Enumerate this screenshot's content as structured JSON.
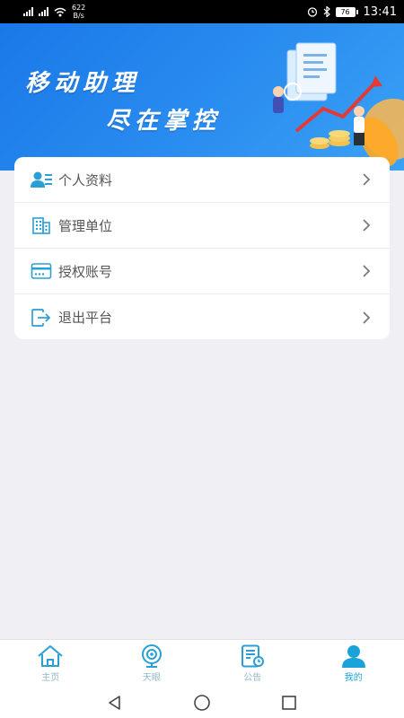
{
  "status_bar": {
    "network_speed": "622",
    "network_speed_unit": "B/s",
    "battery": "76",
    "time": "13:41"
  },
  "banner": {
    "line1": "移动助理",
    "line2": "尽在掌控"
  },
  "menu": {
    "items": [
      {
        "label": "个人资料",
        "icon": "profile-card-icon"
      },
      {
        "label": "管理单位",
        "icon": "building-icon"
      },
      {
        "label": "授权账号",
        "icon": "account-card-icon"
      },
      {
        "label": "退出平台",
        "icon": "exit-icon"
      }
    ]
  },
  "tabbar": {
    "active_index": 3,
    "items": [
      {
        "label": "主页",
        "icon": "home-icon"
      },
      {
        "label": "天眼",
        "icon": "camera-eye-icon"
      },
      {
        "label": "公告",
        "icon": "notice-icon"
      },
      {
        "label": "我的",
        "icon": "user-icon"
      }
    ]
  },
  "colors": {
    "accent": "#1aa3d9",
    "banner_blue": "#1a78e8",
    "icon_blue": "#2a9fd6",
    "inactive_tab": "#8fb7c9"
  }
}
